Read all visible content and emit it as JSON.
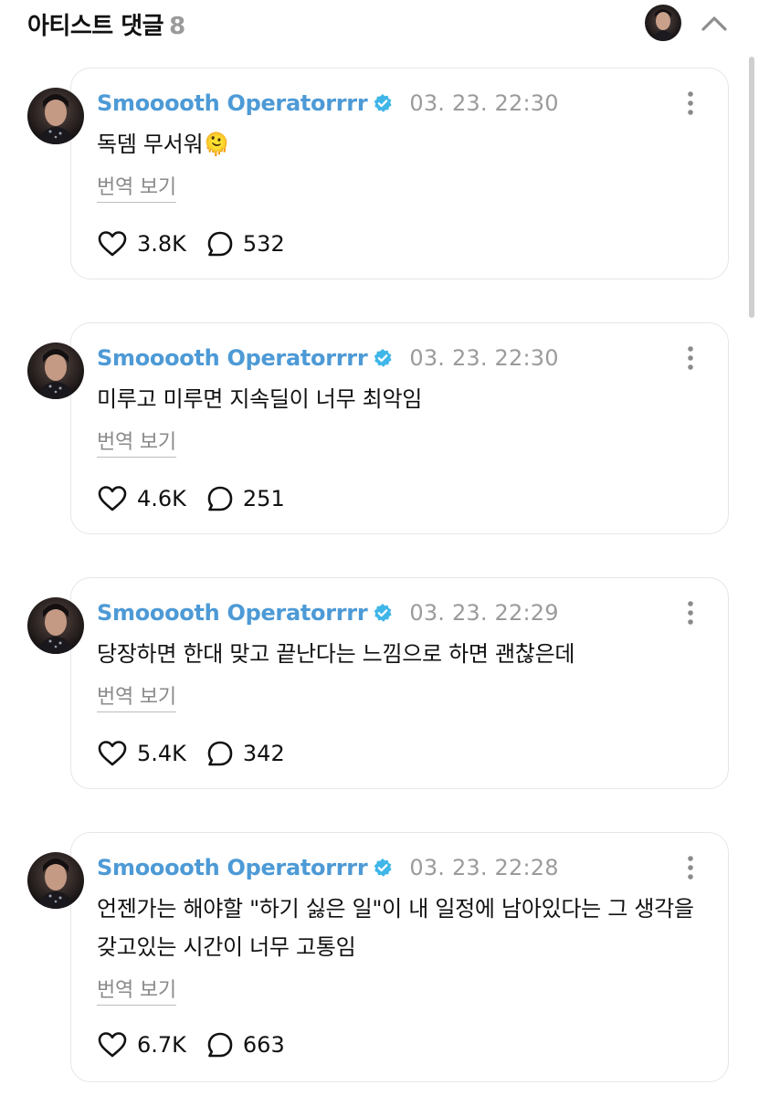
{
  "header": {
    "title": "아티스트 댓글",
    "count": "8"
  },
  "colors": {
    "accent": "#4d9ad6",
    "verified": "#3fb6e8",
    "timestamp": "#9b9b9b",
    "border": "#e6e6e6"
  },
  "comments": [
    {
      "username": "Smooooth Operatorrrr",
      "timestamp": "03. 23. 22:30",
      "text": "독뎀 무서워",
      "emoji": "🫠",
      "translate_label": "번역 보기",
      "likes": "3.8K",
      "replies": "532"
    },
    {
      "username": "Smooooth Operatorrrr",
      "timestamp": "03. 23. 22:30",
      "text": "미루고 미루면 지속딜이 너무 최악임",
      "emoji": "",
      "translate_label": "번역 보기",
      "likes": "4.6K",
      "replies": "251"
    },
    {
      "username": "Smooooth Operatorrrr",
      "timestamp": "03. 23. 22:29",
      "text": "당장하면 한대 맞고 끝난다는 느낌으로 하면 괜찮은데",
      "emoji": "",
      "translate_label": "번역 보기",
      "likes": "5.4K",
      "replies": "342"
    },
    {
      "username": "Smooooth Operatorrrr",
      "timestamp": "03. 23. 22:28",
      "text": "언젠가는 해야할 \"하기 싫은 일\"이 내 일정에 남아있다는 그 생각을 갖고있는 시간이 너무 고통임",
      "emoji": "",
      "translate_label": "번역 보기",
      "likes": "6.7K",
      "replies": "663"
    }
  ]
}
